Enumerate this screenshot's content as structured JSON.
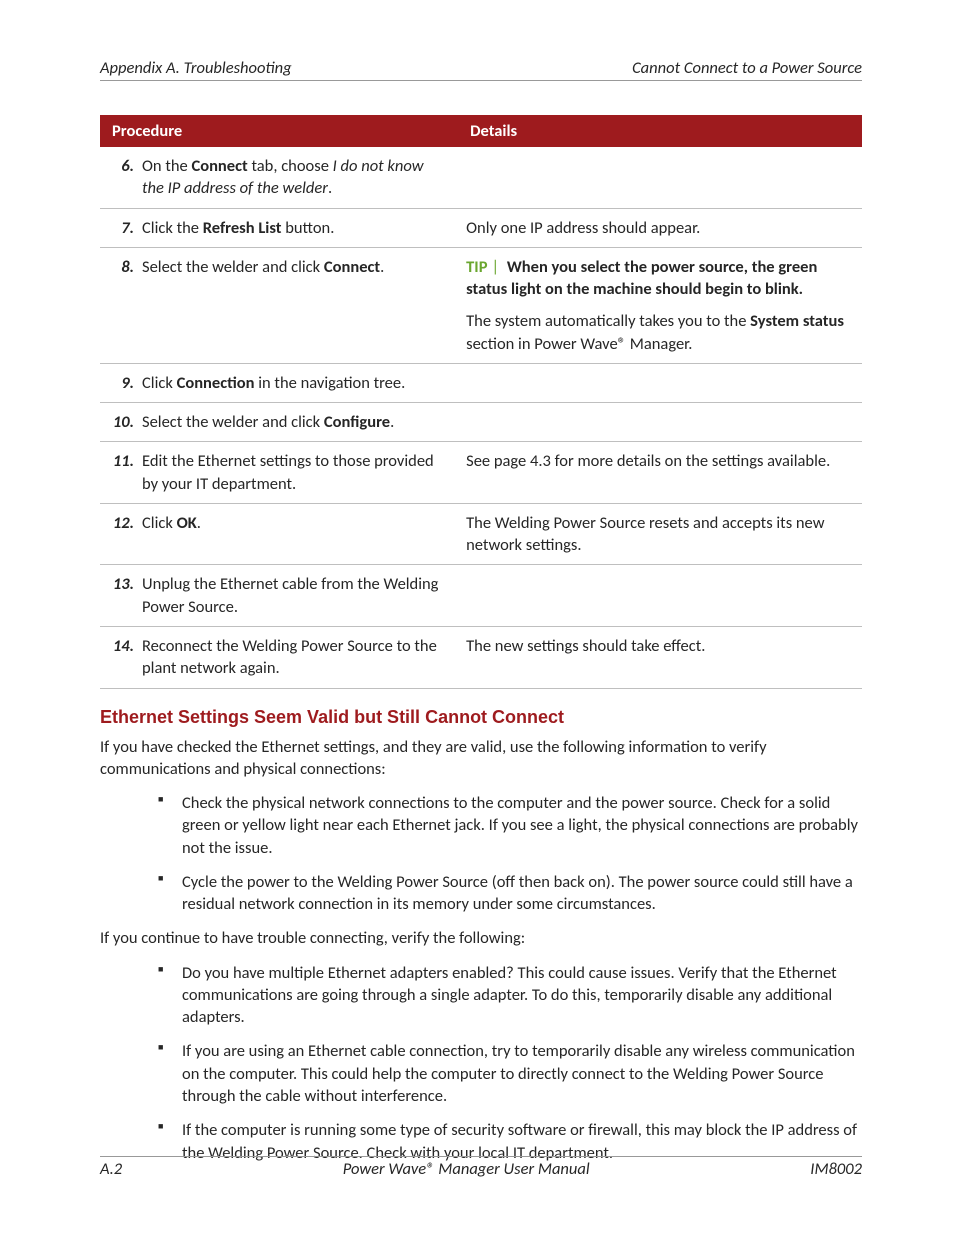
{
  "header": {
    "left": "Appendix A. Troubleshooting",
    "right": "Cannot Connect to a Power Source"
  },
  "table": {
    "col_procedure": "Procedure",
    "col_details": "Details",
    "r6": {
      "num": "6.",
      "t1": "On the ",
      "b1": "Connect",
      "t2": " tab, choose ",
      "i1": "I do not know the IP address of the welder",
      "t3": "."
    },
    "r7": {
      "num": "7.",
      "t1": "Click the ",
      "b1": "Refresh List",
      "t2": " button.",
      "d": "Only one IP address should appear."
    },
    "r8": {
      "num": "8.",
      "t1": "Select the welder and click ",
      "b1": "Connect",
      "t2": ".",
      "tip_label": "TIP",
      "sep": "|",
      "tip_bold": "When you select the power source, the green status light on the machine should begin to blink.",
      "d2a": "The system automatically takes you to the ",
      "d2b": "System status",
      "d2c": " section in Power Wave® Manager."
    },
    "r9": {
      "num": "9.",
      "t1": "Click ",
      "b1": "Connection",
      "t2": " in the navigation tree."
    },
    "r10": {
      "num": "10.",
      "t1": "Select the welder and click ",
      "b1": "Configure",
      "t2": "."
    },
    "r11": {
      "num": "11.",
      "t1": "Edit the Ethernet settings to those provided by your IT department.",
      "d": "See page 4.3 for more details on the settings available."
    },
    "r12": {
      "num": "12.",
      "t1": "Click ",
      "b1": "OK",
      "t2": ".",
      "d": "The Welding Power Source resets and accepts its new network settings."
    },
    "r13": {
      "num": "13.",
      "t1": "Unplug the Ethernet cable from the Welding Power Source."
    },
    "r14": {
      "num": "14.",
      "t1": "Reconnect the Welding Power Source to the plant network again.",
      "d": "The new settings should take effect."
    }
  },
  "section": {
    "heading": "Ethernet Settings Seem Valid but Still Cannot Connect",
    "p1": "If you have checked the Ethernet settings, and they are valid, use the following information to verify communications and physical connections:",
    "list1": {
      "i1": "Check the physical network connections to the computer and the power source.  Check for a solid green or yellow light near each Ethernet jack.  If you see a light, the physical connections are probably not the issue.",
      "i2": "Cycle the power to the Welding Power Source (off then back on).  The power source could still have a residual network connection in its memory under some circumstances."
    },
    "p2": "If you continue to have trouble connecting, verify the following:",
    "list2": {
      "i1": "Do you have multiple Ethernet adapters enabled?  This could cause issues.  Verify that the Ethernet communications are going through a single adapter.  To do this, temporarily disable any additional adapters.",
      "i2": "If you are using an Ethernet cable connection, try to temporarily disable any wireless communication on the computer.  This could help the computer to directly connect to the Welding Power Source through the cable without interference.",
      "i3": "If the computer is running some type of security software or firewall, this may block the IP address of the Welding Power Source.  Check with your local IT department."
    }
  },
  "footer": {
    "left": "A.2",
    "center": "Power Wave® Manager User Manual",
    "right": "IM8002"
  }
}
